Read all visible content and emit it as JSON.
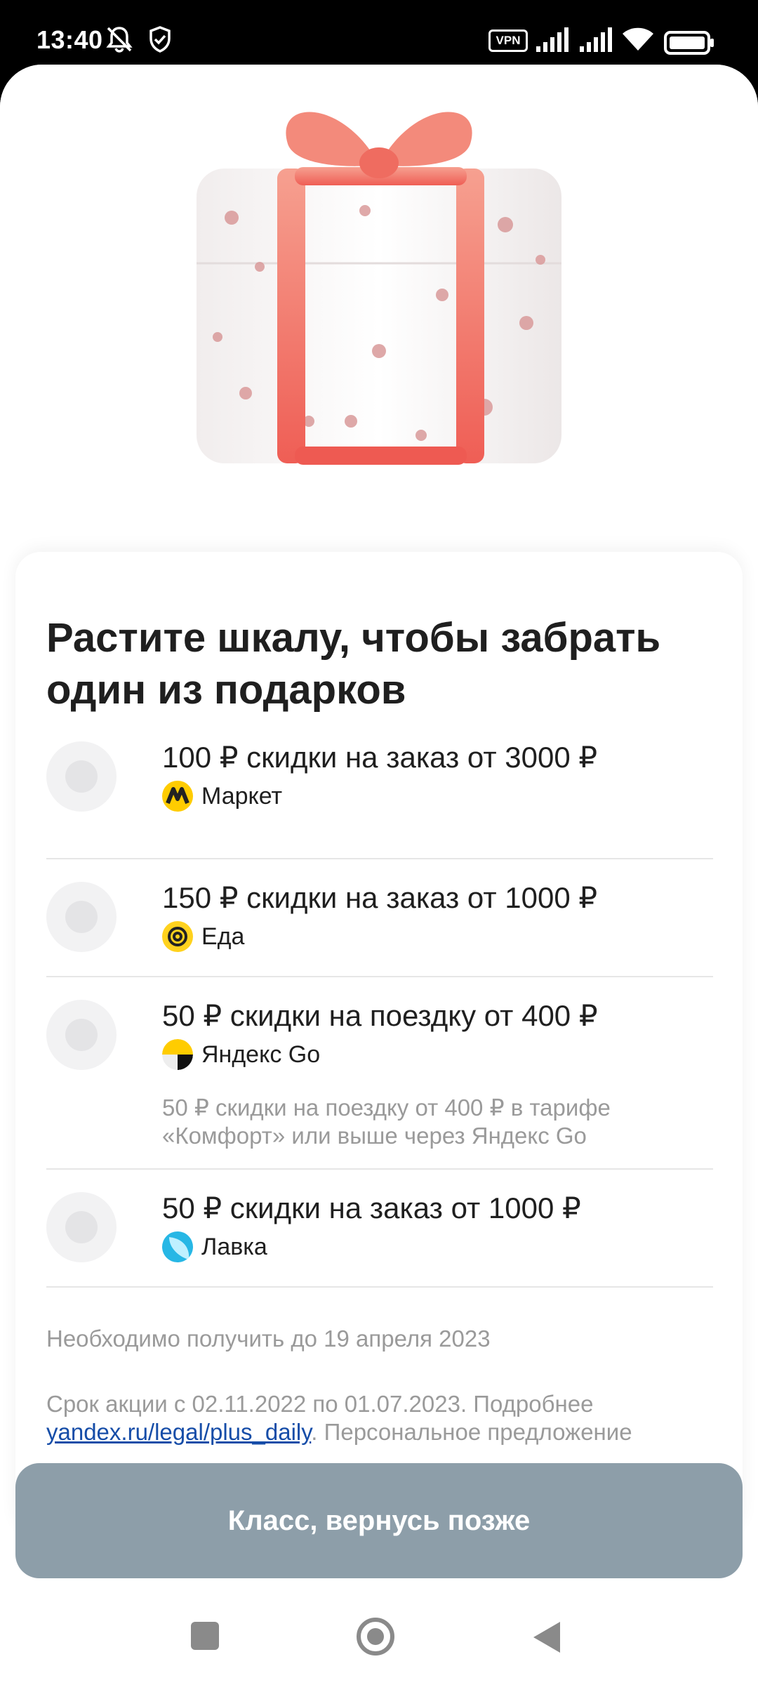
{
  "status_bar": {
    "time": "13:40",
    "vpn_label": "VPN",
    "icons": [
      "bell-muted-icon",
      "shield-icon",
      "signal-icon",
      "signal-icon",
      "wifi-icon",
      "battery-icon"
    ]
  },
  "hero": {
    "image": "gift-box-illustration",
    "colors": {
      "ribbon": "#F57B6E",
      "box": "#F7F5F5",
      "pattern": "#D99A9A"
    }
  },
  "card": {
    "title": "Растите шкалу, чтобы забрать один из подарков",
    "gifts": [
      {
        "title": "100 ₽ скидки на заказ от 3000 ₽",
        "brand": "Маркет",
        "logo": "market-logo-icon",
        "note": ""
      },
      {
        "title": "150 ₽ скидки на заказ от 1000 ₽",
        "brand": "Еда",
        "logo": "eda-logo-icon",
        "note": ""
      },
      {
        "title": "50 ₽ скидки на поездку от 400 ₽",
        "brand": "Яндекс Go",
        "logo": "yandex-go-logo-icon",
        "note": "50 ₽ скидки на поездку от 400 ₽ в тарифе «Комфорт» или выше через Яндекс Go"
      },
      {
        "title": "50 ₽ скидки на заказ от 1000 ₽",
        "brand": "Лавка",
        "logo": "lavka-logo-icon",
        "note": ""
      }
    ],
    "deadline": "Необходимо получить до 19 апреля 2023",
    "terms_prefix": "Срок акции с 02.11.2022 по 01.07.2023. Подробнее",
    "terms_link": "yandex.ru/legal/plus_daily",
    "terms_suffix": ". Персональное предложение"
  },
  "cta": {
    "label": "Класс, вернусь позже",
    "color": "#8D9EA9"
  },
  "nav": {
    "icons": [
      "recents-square-icon",
      "home-circle-icon",
      "back-triangle-icon"
    ]
  }
}
